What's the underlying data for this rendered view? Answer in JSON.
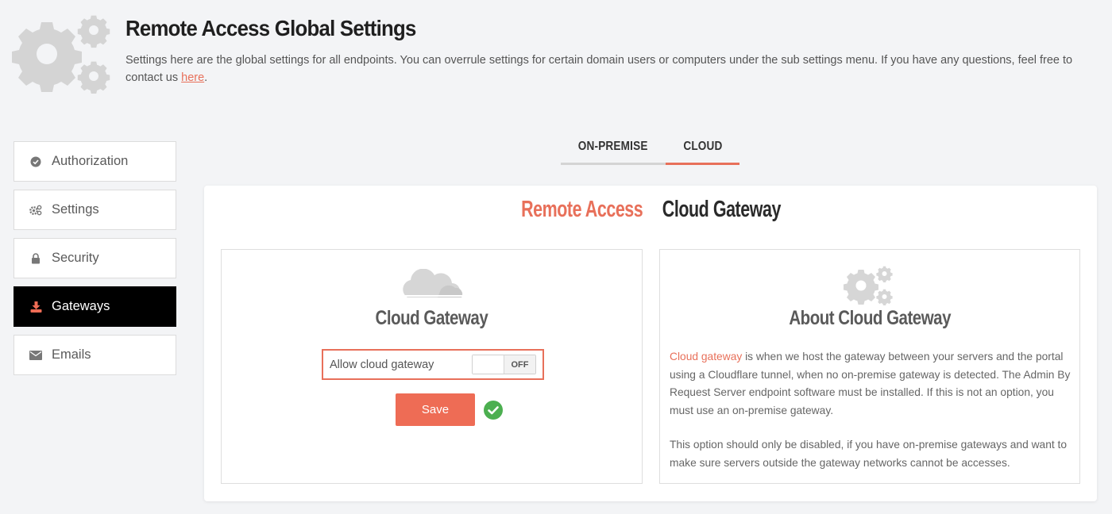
{
  "header": {
    "title": "Remote Access Global Settings",
    "description": "Settings here are the global settings for all endpoints. You can overrule settings for certain domain users or computers under the sub settings menu. If you have any questions, feel free to contact us ",
    "link_text": "here",
    "description_end": ".",
    "icon": "gears-icon"
  },
  "sidebar": {
    "items": [
      {
        "label": "Authorization",
        "icon": "check-circle-icon",
        "active": false
      },
      {
        "label": "Settings",
        "icon": "gears-icon",
        "active": false
      },
      {
        "label": "Security",
        "icon": "lock-icon",
        "active": false
      },
      {
        "label": "Gateways",
        "icon": "download-icon",
        "active": true
      },
      {
        "label": "Emails",
        "icon": "envelope-icon",
        "active": false
      }
    ]
  },
  "tabs": [
    {
      "label": "ON-PREMISE",
      "active": false
    },
    {
      "label": "CLOUD",
      "active": true
    }
  ],
  "card": {
    "title_accent": "Remote Access",
    "title_rest": " Cloud Gateway",
    "left_panel": {
      "icon": "cloud-icon",
      "heading": "Cloud Gateway",
      "toggle_label": "Allow cloud gateway",
      "toggle_state": "OFF",
      "save_label": "Save",
      "status_icon": "check-circle-icon"
    },
    "right_panel": {
      "icon": "gears-icon",
      "heading": "About Cloud Gateway",
      "p1_highlight": "Cloud gateway",
      "p1_rest": " is when we host the gateway between your servers and the portal using a Cloudflare tunnel, when no on-premise gateway is detected. The Admin By Request Server endpoint software must be installed. If this is not an option, you must use an on-premise gateway.",
      "p2": "This option should only be disabled, if you have on-premise gateways and want to make sure servers outside the gateway networks cannot be accesses."
    }
  },
  "colors": {
    "accent": "#e8705a",
    "active_nav": "#000000",
    "success": "#4caf50"
  }
}
